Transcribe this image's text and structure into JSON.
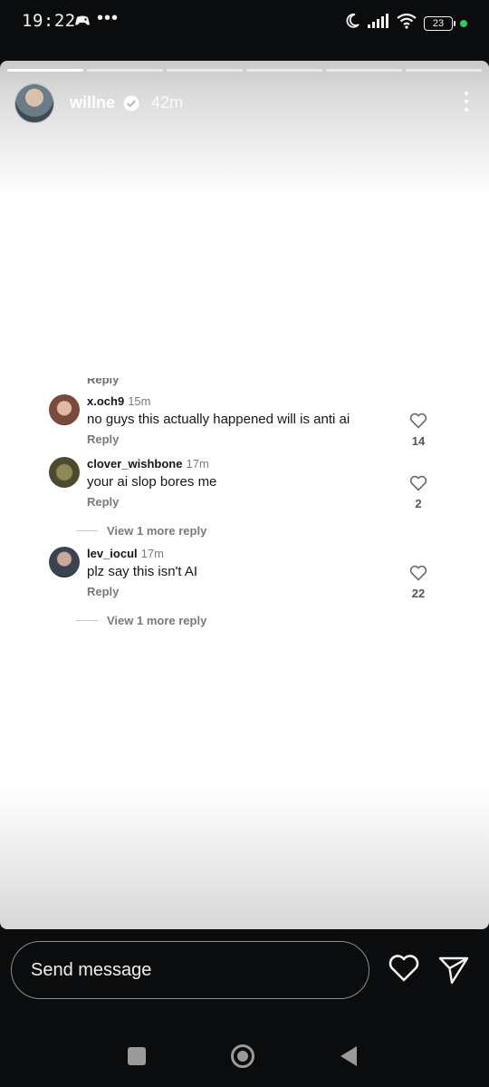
{
  "status_bar": {
    "time": "19:22",
    "battery": "23",
    "icons": [
      "game-controller-icon",
      "more-dots-icon",
      "moon-icon",
      "signal-icon",
      "wifi-icon",
      "battery-icon",
      "green-privacy-dot"
    ]
  },
  "story": {
    "username": "willne",
    "time_ago": "42m",
    "progress_segments": 6,
    "progress_done": 1
  },
  "comments": {
    "cut_top_text": "Reply",
    "items": [
      {
        "user": "x.och9",
        "time": "15m",
        "text": "no guys this actually happened will is anti ai",
        "reply": "Reply",
        "likes": "14"
      },
      {
        "user": "clover_wishbone",
        "time": "17m",
        "text": "your ai slop bores me",
        "reply": "Reply",
        "likes": "2",
        "view_more": "View 1 more reply"
      },
      {
        "user": "lev_iocul",
        "time": "17m",
        "text": "plz say this isn't AI",
        "reply": "Reply",
        "likes": "22",
        "view_more": "View 1 more reply"
      }
    ]
  },
  "bottom_bar": {
    "message_placeholder": "Send message"
  },
  "colors": {
    "background": "#0b0c0e",
    "accent_green": "#34c759"
  }
}
